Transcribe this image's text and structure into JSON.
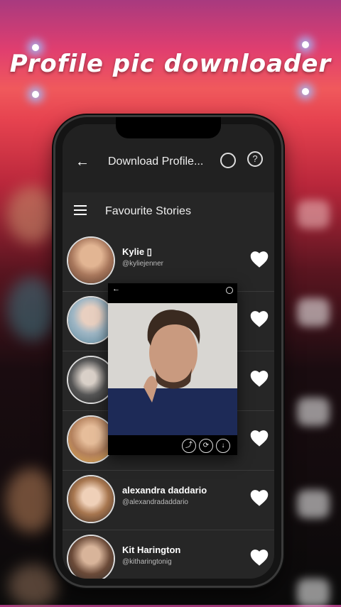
{
  "banner": {
    "title": "Profile pic downloader"
  },
  "appbar": {
    "back_icon": "←",
    "title": "Download Profile...",
    "help_label": "?"
  },
  "toolbar": {
    "title": "Favourite Stories"
  },
  "popup": {
    "back_icon": "←",
    "share_icon": "share-icon",
    "repost_icon": "repost-icon",
    "download_icon": "download-icon"
  },
  "profiles": [
    {
      "name": "Kylie ▯",
      "handle": "@kyliejenner"
    },
    {
      "name": "",
      "handle": ""
    },
    {
      "name": "",
      "handle": ""
    },
    {
      "name": "",
      "handle": ""
    },
    {
      "name": "alexandra daddario",
      "handle": "@alexandradaddario"
    },
    {
      "name": "Kit Harington",
      "handle": "@kitharingtonig"
    }
  ],
  "colors": {
    "accent": "#e03e6f",
    "background": "#262626",
    "heart": "#ffffff"
  }
}
